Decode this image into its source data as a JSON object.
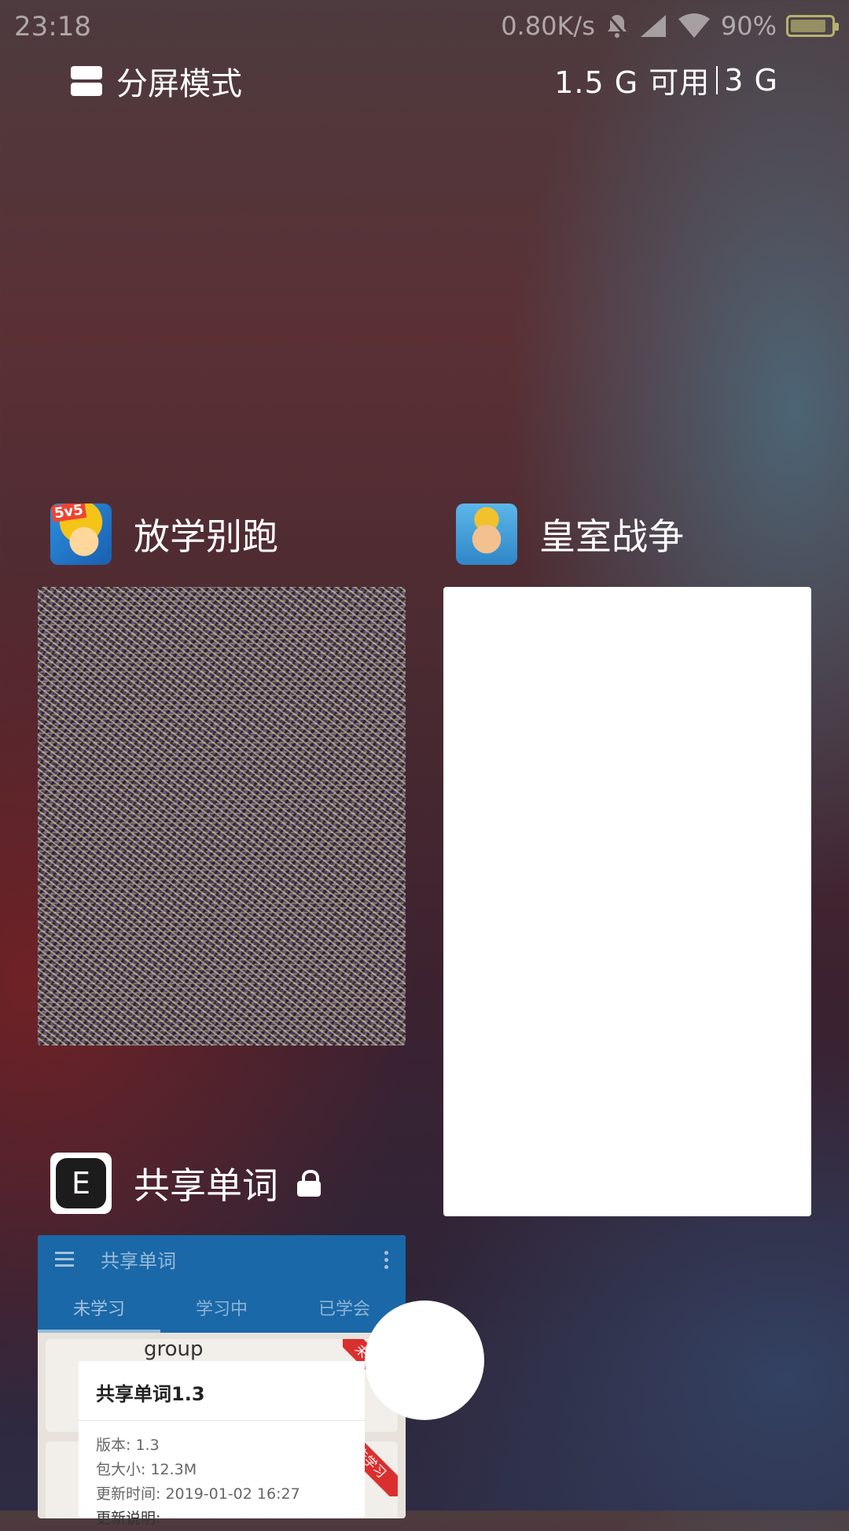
{
  "status_bar": {
    "time": "23:18",
    "net_speed": "0.80K/s",
    "battery": "90%",
    "battery_level": 0.9,
    "icons": [
      "bell-muted-icon",
      "cellular-signal-icon",
      "wifi-icon",
      "battery-icon"
    ]
  },
  "header": {
    "split_mode_label": "分屏模式",
    "memory_available": "1.5 G 可用",
    "memory_total": "3 G"
  },
  "apps": [
    {
      "name": "放学别跑",
      "icon": "game-hero-icon",
      "icon_badge": "5v5"
    },
    {
      "name": "皇室战争",
      "icon": "clash-royale-king-icon"
    },
    {
      "name": "共享单词",
      "icon": "vocab-e-icon",
      "icon_letter": "E",
      "locked": true
    }
  ],
  "vocab_preview": {
    "toolbar_title": "共享单词",
    "tabs": [
      "未学习",
      "学习中",
      "已学会"
    ],
    "active_tab": 0,
    "word": "group",
    "ribbon_label": "未学习",
    "popup": {
      "title": "共享单词1.3",
      "version": "版本: 1.3",
      "size": "包大小: 12.3M",
      "update_time": "更新时间: 2019-01-02 16:27",
      "update_notes": "更新说明:"
    }
  },
  "colors": {
    "vocab_primary": "#1a68a8",
    "ribbon_red": "#d9302f"
  }
}
